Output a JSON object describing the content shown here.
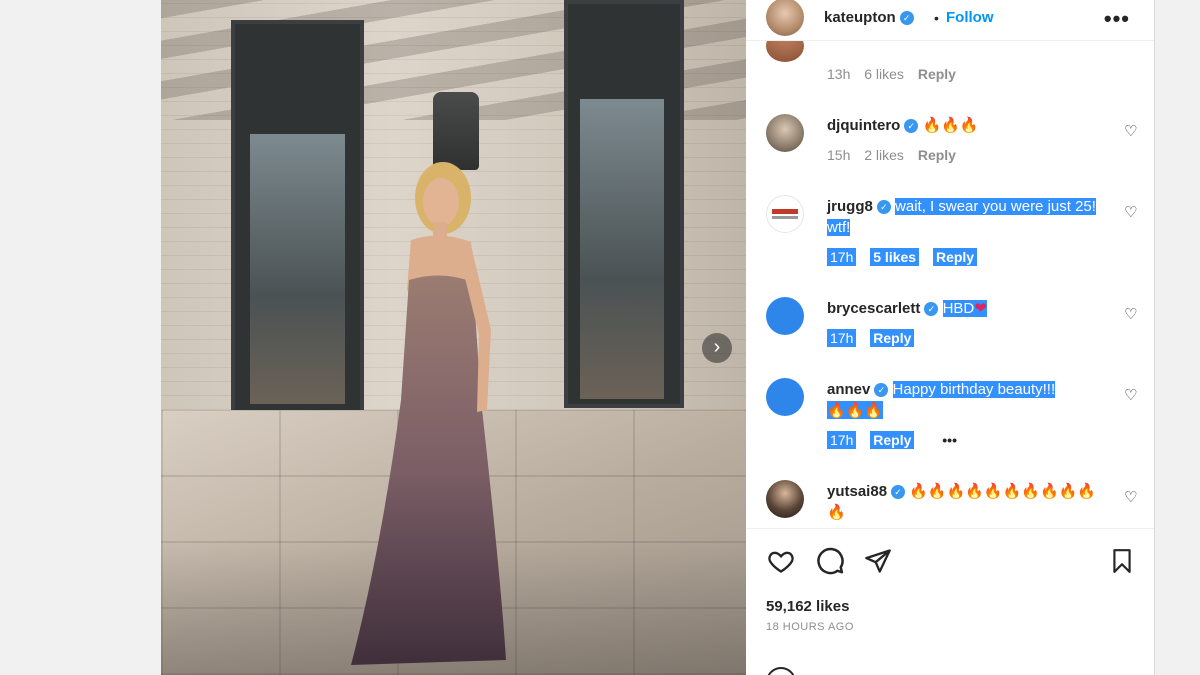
{
  "post": {
    "author": "kateupton",
    "follow_label": "Follow",
    "separator": "•",
    "more_label": "•••",
    "next_label": "›",
    "likes": "59,162 likes",
    "time": "18 HOURS AGO"
  },
  "comments": [
    {
      "user": "",
      "text": "",
      "time": "13h",
      "likes": "6 likes",
      "reply": "Reply"
    },
    {
      "user": "djquintero",
      "text": "🔥🔥🔥",
      "time": "15h",
      "likes": "2 likes",
      "reply": "Reply"
    },
    {
      "user": "jrugg8",
      "text": "wait, I swear you were just 25! wtf!",
      "time": "17h",
      "likes": "5 likes",
      "reply": "Reply"
    },
    {
      "user": "brycescarlett",
      "text": "HBD",
      "heart": "❤",
      "time": "17h",
      "reply": "Reply"
    },
    {
      "user": "annev",
      "text": "Happy birthday beauty!!!",
      "text2": "🔥🔥🔥",
      "time": "17h",
      "reply": "Reply",
      "more": "•••"
    },
    {
      "user": "yutsai88",
      "text": "🔥🔥🔥🔥🔥🔥🔥🔥🔥🔥",
      "text2": "🔥"
    }
  ],
  "colors": {
    "accent": "#0095f6",
    "verified": "#3897f0",
    "highlight": "#3390ff"
  },
  "icons": [
    "heart-icon",
    "comment-icon",
    "share-icon",
    "bookmark-icon",
    "chevron-right-icon",
    "verified-icon"
  ]
}
